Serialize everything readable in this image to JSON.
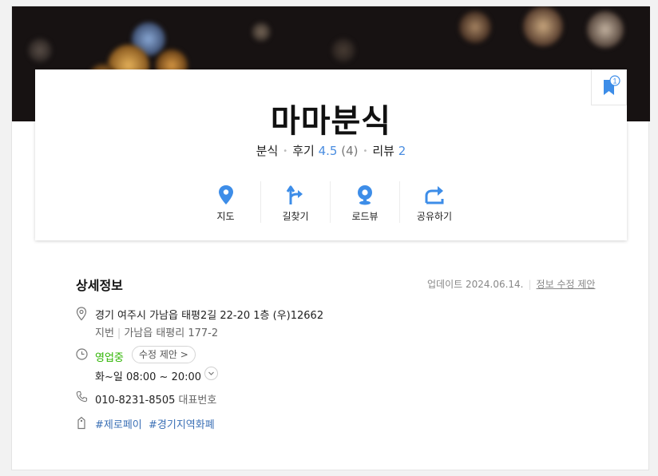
{
  "place": {
    "name": "마마분식",
    "category": "분식",
    "review_label": "후기",
    "rating": "4.5",
    "rating_count": "(4)",
    "blog_label": "리뷰",
    "blog_count": "2",
    "bookmark_count": "1"
  },
  "actions": [
    {
      "label": "지도",
      "icon": "map-pin-icon"
    },
    {
      "label": "길찾기",
      "icon": "directions-icon"
    },
    {
      "label": "로드뷰",
      "icon": "roadview-icon"
    },
    {
      "label": "공유하기",
      "icon": "share-icon"
    }
  ],
  "detail": {
    "title": "상세정보",
    "updated": "업데이트 2024.06.14.",
    "suggest_edit": "정보 수정 제안",
    "address": "경기 여주시 가남읍 태평2길 22-20 1층 (우)12662",
    "lot_label": "지번",
    "lot_address": "가남읍 태평리 177-2",
    "status": "영업중",
    "edit_pill": "수정 제안 >",
    "hours": "화~일  08:00 ~ 20:00",
    "phone": "010-8231-8505",
    "phone_label": "대표번호",
    "tags": [
      "#제로페이",
      "#경기지역화폐"
    ]
  },
  "colors": {
    "accent": "#3d8de8",
    "open": "#2db400",
    "tag": "#3a6fb5"
  }
}
